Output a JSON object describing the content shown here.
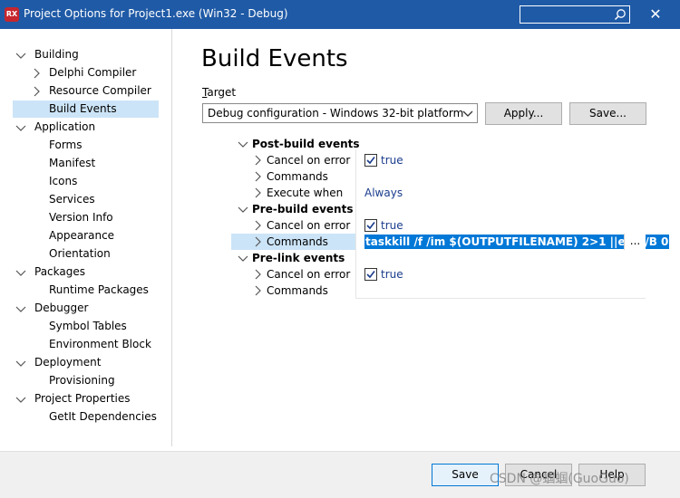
{
  "window": {
    "icon_text": "RX",
    "title": "Project Options for Project1.exe  (Win32 - Debug)",
    "close_glyph": "✕"
  },
  "tree": {
    "items": [
      {
        "label": "Building",
        "level": 0,
        "expander": "expanded"
      },
      {
        "label": "Delphi Compiler",
        "level": 1,
        "expander": "collapsed"
      },
      {
        "label": "Resource Compiler",
        "level": 1,
        "expander": "collapsed"
      },
      {
        "label": "Build Events",
        "level": 1,
        "expander": "none",
        "selected": true
      },
      {
        "label": "Application",
        "level": 0,
        "expander": "expanded"
      },
      {
        "label": "Forms",
        "level": 1,
        "expander": "none"
      },
      {
        "label": "Manifest",
        "level": 1,
        "expander": "none"
      },
      {
        "label": "Icons",
        "level": 1,
        "expander": "none"
      },
      {
        "label": "Services",
        "level": 1,
        "expander": "none"
      },
      {
        "label": "Version Info",
        "level": 1,
        "expander": "none"
      },
      {
        "label": "Appearance",
        "level": 1,
        "expander": "none"
      },
      {
        "label": "Orientation",
        "level": 1,
        "expander": "none"
      },
      {
        "label": "Packages",
        "level": 0,
        "expander": "expanded"
      },
      {
        "label": "Runtime Packages",
        "level": 1,
        "expander": "none"
      },
      {
        "label": "Debugger",
        "level": 0,
        "expander": "expanded"
      },
      {
        "label": "Symbol Tables",
        "level": 1,
        "expander": "none"
      },
      {
        "label": "Environment Block",
        "level": 1,
        "expander": "none"
      },
      {
        "label": "Deployment",
        "level": 0,
        "expander": "expanded"
      },
      {
        "label": "Provisioning",
        "level": 1,
        "expander": "none"
      },
      {
        "label": "Project Properties",
        "level": 0,
        "expander": "expanded"
      },
      {
        "label": "GetIt Dependencies",
        "level": 1,
        "expander": "none"
      }
    ]
  },
  "main": {
    "heading": "Build Events",
    "target_label_first": "T",
    "target_label_rest": "arget",
    "target_value": "Debug configuration - Windows 32-bit platform",
    "apply_label": "Apply...",
    "save_label": "Save..."
  },
  "grid": {
    "rows": [
      {
        "kind": "category",
        "label": "Post-build events"
      },
      {
        "kind": "prop",
        "label": "Cancel on error",
        "value_type": "check",
        "value": "true",
        "checked": true
      },
      {
        "kind": "prop",
        "label": "Commands",
        "value_type": "text",
        "value": ""
      },
      {
        "kind": "prop",
        "label": "Execute when",
        "value_type": "text",
        "value": "Always"
      },
      {
        "kind": "category",
        "label": "Pre-build events"
      },
      {
        "kind": "prop",
        "label": "Cancel on error",
        "value_type": "check",
        "value": "true",
        "checked": true
      },
      {
        "kind": "prop",
        "label": "Commands",
        "value_type": "edit",
        "value": "taskkill /f /im $(OUTPUTFILENAME) 2>1 ||exit /B 0",
        "selected": true,
        "button": "..."
      },
      {
        "kind": "category",
        "label": "Pre-link events"
      },
      {
        "kind": "prop",
        "label": "Cancel on error",
        "value_type": "check",
        "value": "true",
        "checked": true
      },
      {
        "kind": "prop",
        "label": "Commands",
        "value_type": "text",
        "value": ""
      }
    ]
  },
  "footer": {
    "save_label": "Save",
    "cancel_label": "Cancel",
    "help_label": "Help"
  },
  "watermark": "CSDN @蝈蝈(GuoGuo)",
  "colors": {
    "titlebar": "#1f5aa6",
    "selection": "#cce4f7",
    "highlight": "#0078d7",
    "value_blue": "#1a3c8c"
  }
}
